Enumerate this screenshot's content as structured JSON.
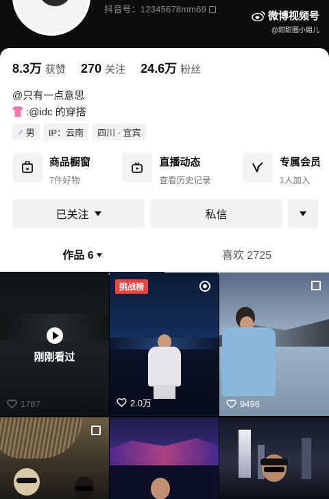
{
  "header": {
    "douyin_id": "抖音号：12345678mm69",
    "watermark_title": "微博视频号",
    "watermark_sub": "@甜甜圈小姐儿"
  },
  "stats": [
    {
      "num": "8.3万",
      "label": "获赞"
    },
    {
      "num": "270",
      "label": "关注"
    },
    {
      "num": "24.6万",
      "label": "粉丝"
    }
  ],
  "bio": {
    "line1": "@只有一点意思",
    "line2": ":@idc 的穿搭"
  },
  "tags": {
    "gender": "男",
    "ip": "IP：云南",
    "location": "四川 · 宜宾"
  },
  "features": [
    {
      "title": "商品橱窗",
      "sub": "7件好物",
      "icon": "shop-window-icon"
    },
    {
      "title": "直播动态",
      "sub": "查看历史记录",
      "icon": "live-tv-icon"
    },
    {
      "title": "专属会员",
      "sub": "1人加入",
      "icon": "member-icon"
    }
  ],
  "actions": {
    "follow": "已关注",
    "message": "私信"
  },
  "tabs": {
    "works": "作品 6",
    "likes": "喜欢 2725"
  },
  "grid": {
    "just_watched": "刚刚看过",
    "cell1_likes": "1787",
    "cell2_badge": "挑战榜",
    "cell2_likes": "2.0万",
    "cell3_likes": "9496"
  }
}
